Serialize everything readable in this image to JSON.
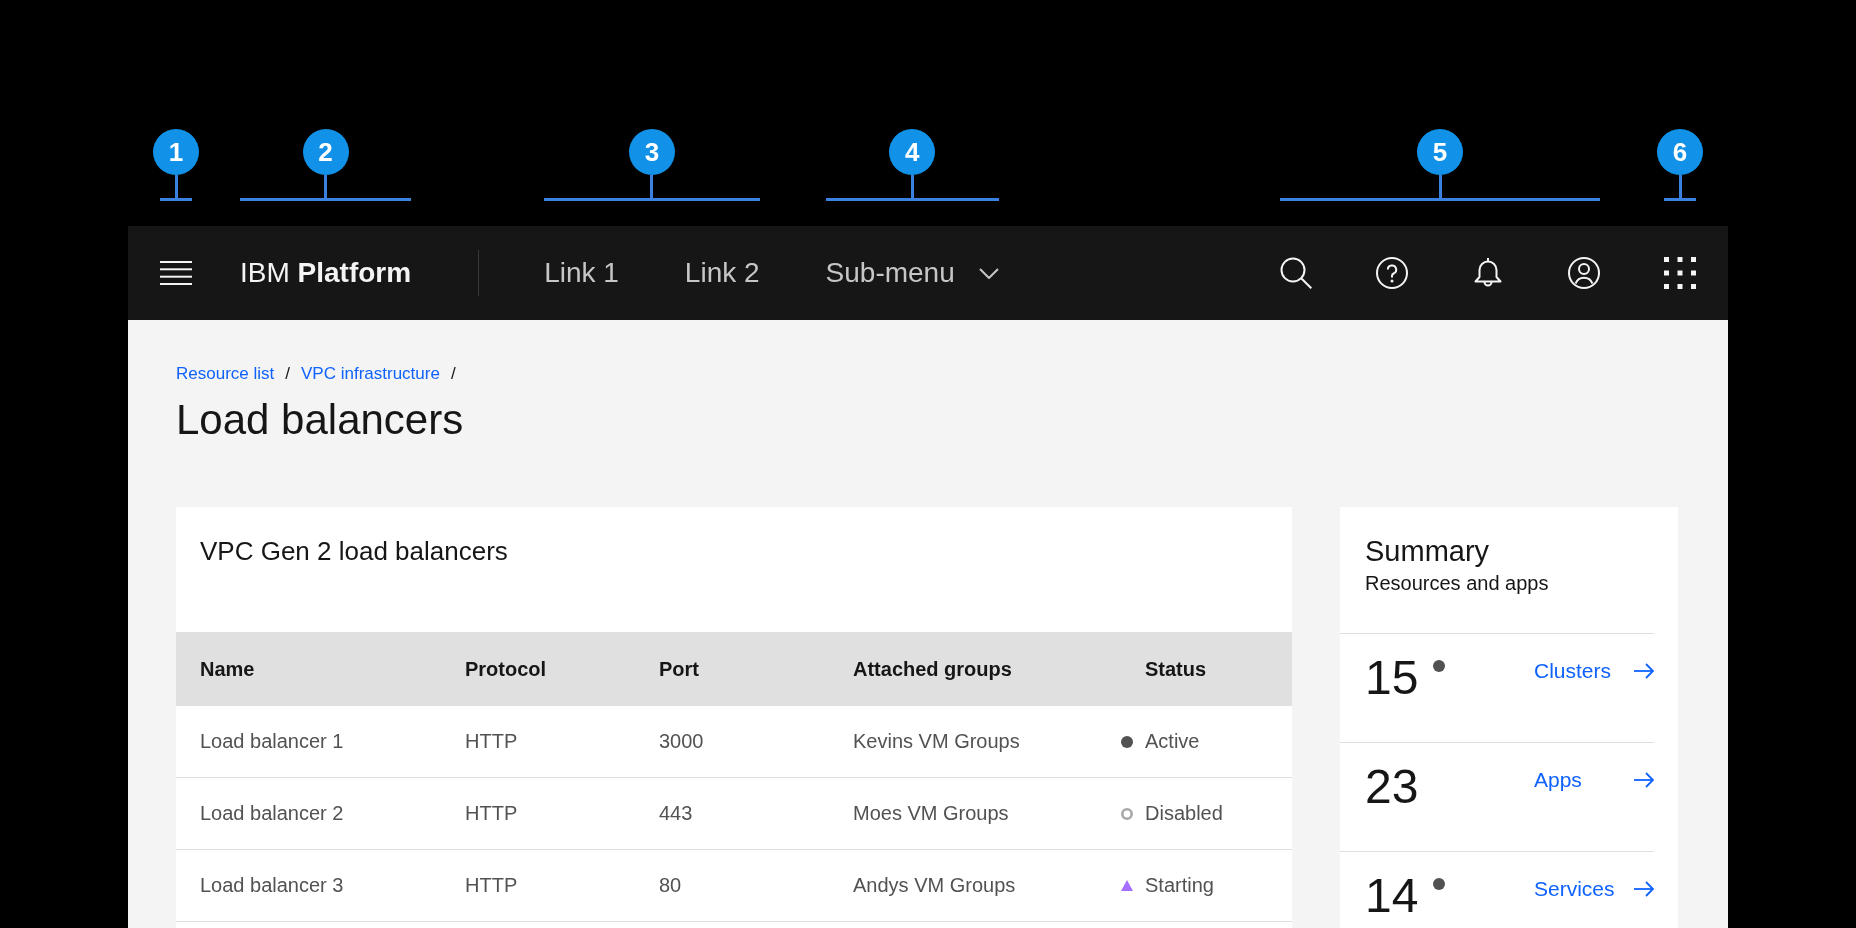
{
  "callouts": [
    {
      "number": "1"
    },
    {
      "number": "2"
    },
    {
      "number": "3"
    },
    {
      "number": "4"
    },
    {
      "number": "5"
    },
    {
      "number": "6"
    }
  ],
  "header": {
    "brand": "IBM **Platform**",
    "links": [
      {
        "label": "Link 1"
      },
      {
        "label": "Link 2"
      }
    ],
    "submenu": {
      "label": "Sub-menu"
    }
  },
  "breadcrumb": [
    {
      "label": "Resource list",
      "separator": "/"
    },
    {
      "label": "VPC infrastructure",
      "separator": "/"
    }
  ],
  "page_title": "Load balancers",
  "table_card": {
    "title": "VPC Gen 2 load balancers",
    "columns": [
      {
        "label": "Name"
      },
      {
        "label": "Protocol"
      },
      {
        "label": "Port"
      },
      {
        "label": "Attached groups"
      },
      {
        "label": "Status"
      }
    ],
    "rows": [
      {
        "cells": [
          "Load balancer 1",
          "HTTP",
          "3000",
          "Kevins VM Groups"
        ],
        "status": {
          "label": "Active",
          "kind": "active",
          "color": "#525252"
        }
      },
      {
        "cells": [
          "Load balancer 2",
          "HTTP",
          "443",
          "Moes VM Groups"
        ],
        "status": {
          "label": "Disabled",
          "kind": "disabled",
          "color": "#a8a8a8"
        }
      },
      {
        "cells": [
          "Load balancer 3",
          "HTTP",
          "80",
          "Andys VM Groups"
        ],
        "status": {
          "label": "Starting",
          "kind": "starting",
          "color": "#a56eff"
        }
      }
    ]
  },
  "summary": {
    "title": "Summary",
    "subtitle": "Resources and apps",
    "items": [
      {
        "count": "15",
        "indicator": true,
        "link": "Clusters"
      },
      {
        "count": "23",
        "indicator": false,
        "link": "Apps"
      },
      {
        "count": "14",
        "indicator": true,
        "link": "Services"
      }
    ]
  }
}
